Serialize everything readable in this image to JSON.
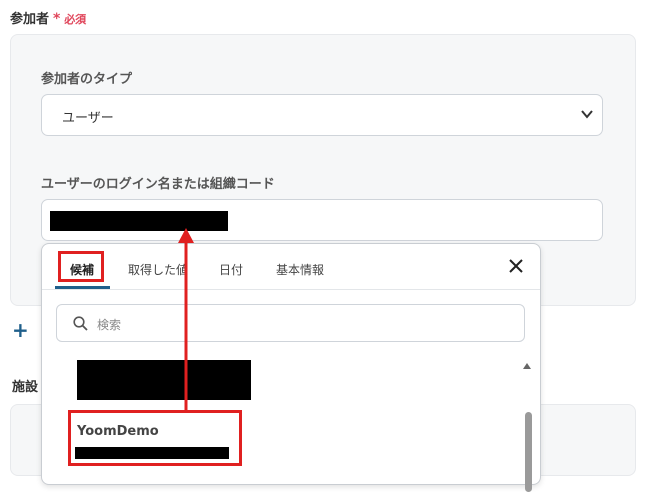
{
  "participants": {
    "label": "参加者",
    "required_star": "*",
    "required_text": "必須",
    "type_label": "参加者のタイプ",
    "type_value": "ユーザー",
    "login_label": "ユーザーのログイン名または組織コード"
  },
  "popup": {
    "tabs": [
      {
        "label": "候補"
      },
      {
        "label": "取得した値"
      },
      {
        "label": "日付"
      },
      {
        "label": "基本情報"
      }
    ],
    "search_placeholder": "検索",
    "items": [
      {
        "name": ""
      },
      {
        "name": "YoomDemo"
      }
    ]
  },
  "facility": {
    "label": "施設"
  },
  "colors": {
    "accent": "#1f5f8b",
    "required": "#e0455a",
    "annotation": "#e02020"
  }
}
